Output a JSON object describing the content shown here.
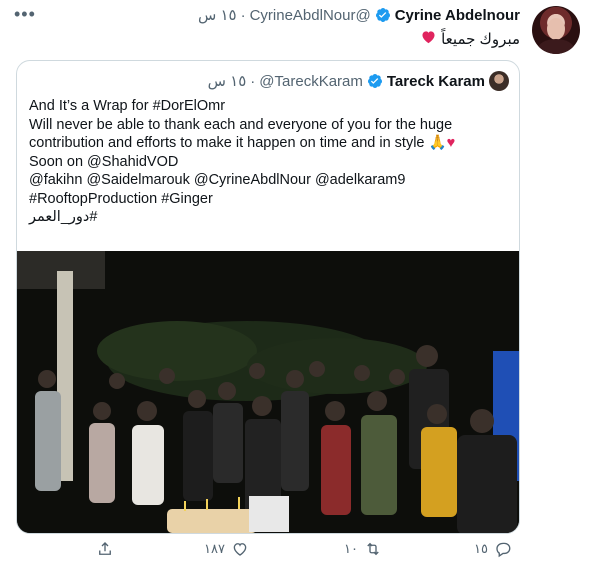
{
  "tweet": {
    "author_name": "Cyrine Abdelnour",
    "author_handle": "@CyrineAbdlNour",
    "dot": "·",
    "time": "١٥ س",
    "text": "مبروك جميعاً",
    "more_icon": "more-icon"
  },
  "quoted": {
    "author_name": "Tareck Karam",
    "author_handle": "@TareckKaram",
    "dot": "·",
    "time": "١٥ س",
    "lines": [
      "And It’s a Wrap for #DorElOmr",
      "Will never be able to thank each and everyone of you for the huge",
      "contribution and efforts to make it happen on time and in style",
      "Soon on @ShahidVOD",
      "@fakihn @Saidelmarouk @CyrineAbdlNour @adelkaram9",
      "#RooftopProduction #Ginger",
      "#دور_العمر"
    ],
    "emoji_pray": "🙏",
    "emoji_heart": "♥"
  },
  "actions": {
    "reply_count": "١٥",
    "retweet_count": "١٠",
    "like_count": "١٨٧"
  },
  "colors": {
    "verified": "#1d9bf0",
    "heart": "#e0245e",
    "muted": "#536471",
    "border": "#cfd9de"
  }
}
